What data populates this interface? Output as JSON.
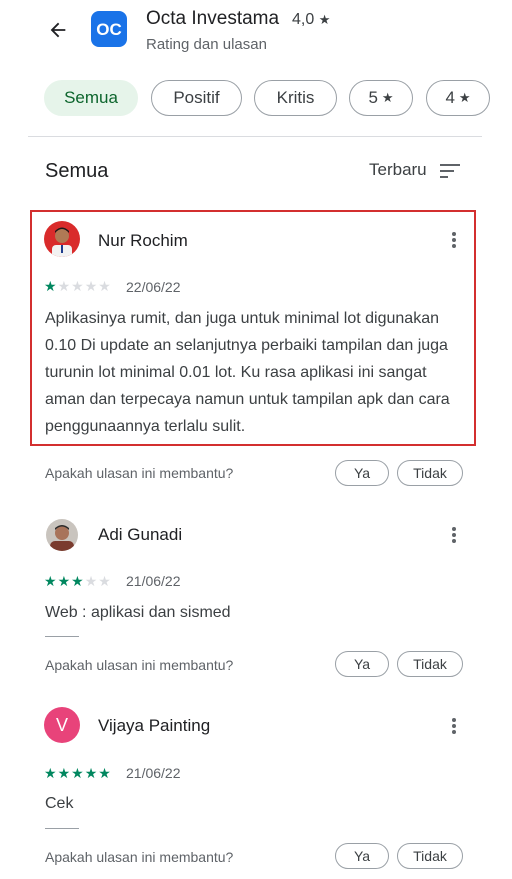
{
  "header": {
    "app_title": "Octa Investama",
    "rating": "4,0",
    "rating_star": "★",
    "subtitle": "Rating dan ulasan",
    "app_icon_text": "OC"
  },
  "filters": {
    "chips": [
      {
        "label": "Semua",
        "active": true
      },
      {
        "label": "Positif",
        "active": false
      },
      {
        "label": "Kritis",
        "active": false
      },
      {
        "label": "5",
        "star": "★",
        "active": false
      },
      {
        "label": "4",
        "star": "★",
        "active": false
      }
    ]
  },
  "section": {
    "title": "Semua",
    "sort_label": "Terbaru"
  },
  "helpful": {
    "question": "Apakah ulasan ini membantu?",
    "yes": "Ya",
    "no": "Tidak"
  },
  "reviews": [
    {
      "name": "Nur Rochim",
      "rating": 1,
      "date": "22/06/22",
      "text": "Aplikasinya rumit, dan juga untuk minimal lot digunakan 0.10 Di update an selanjutnya perbaiki tampilan dan juga turunin lot minimal 0.01 lot. Ku rasa aplikasi ini sangat aman dan terpecaya namun untuk tampilan apk dan cara penggunaannya terlalu sulit.",
      "avatar": "photo"
    },
    {
      "name": "Adi Gunadi",
      "rating": 3,
      "date": "21/06/22",
      "text": "Web : aplikasi dan sismed",
      "avatar": "photo"
    },
    {
      "name": "Vijaya Painting",
      "rating": 5,
      "date": "21/06/22",
      "text": "Cek",
      "avatar": "letter",
      "avatar_letter": "V",
      "avatar_color": "#e8437a"
    }
  ],
  "colors": {
    "accent_green": "#01875f",
    "chip_active_bg": "#e6f4ea",
    "highlight_border": "#d32f2f",
    "app_icon_bg": "#1a73e8"
  }
}
